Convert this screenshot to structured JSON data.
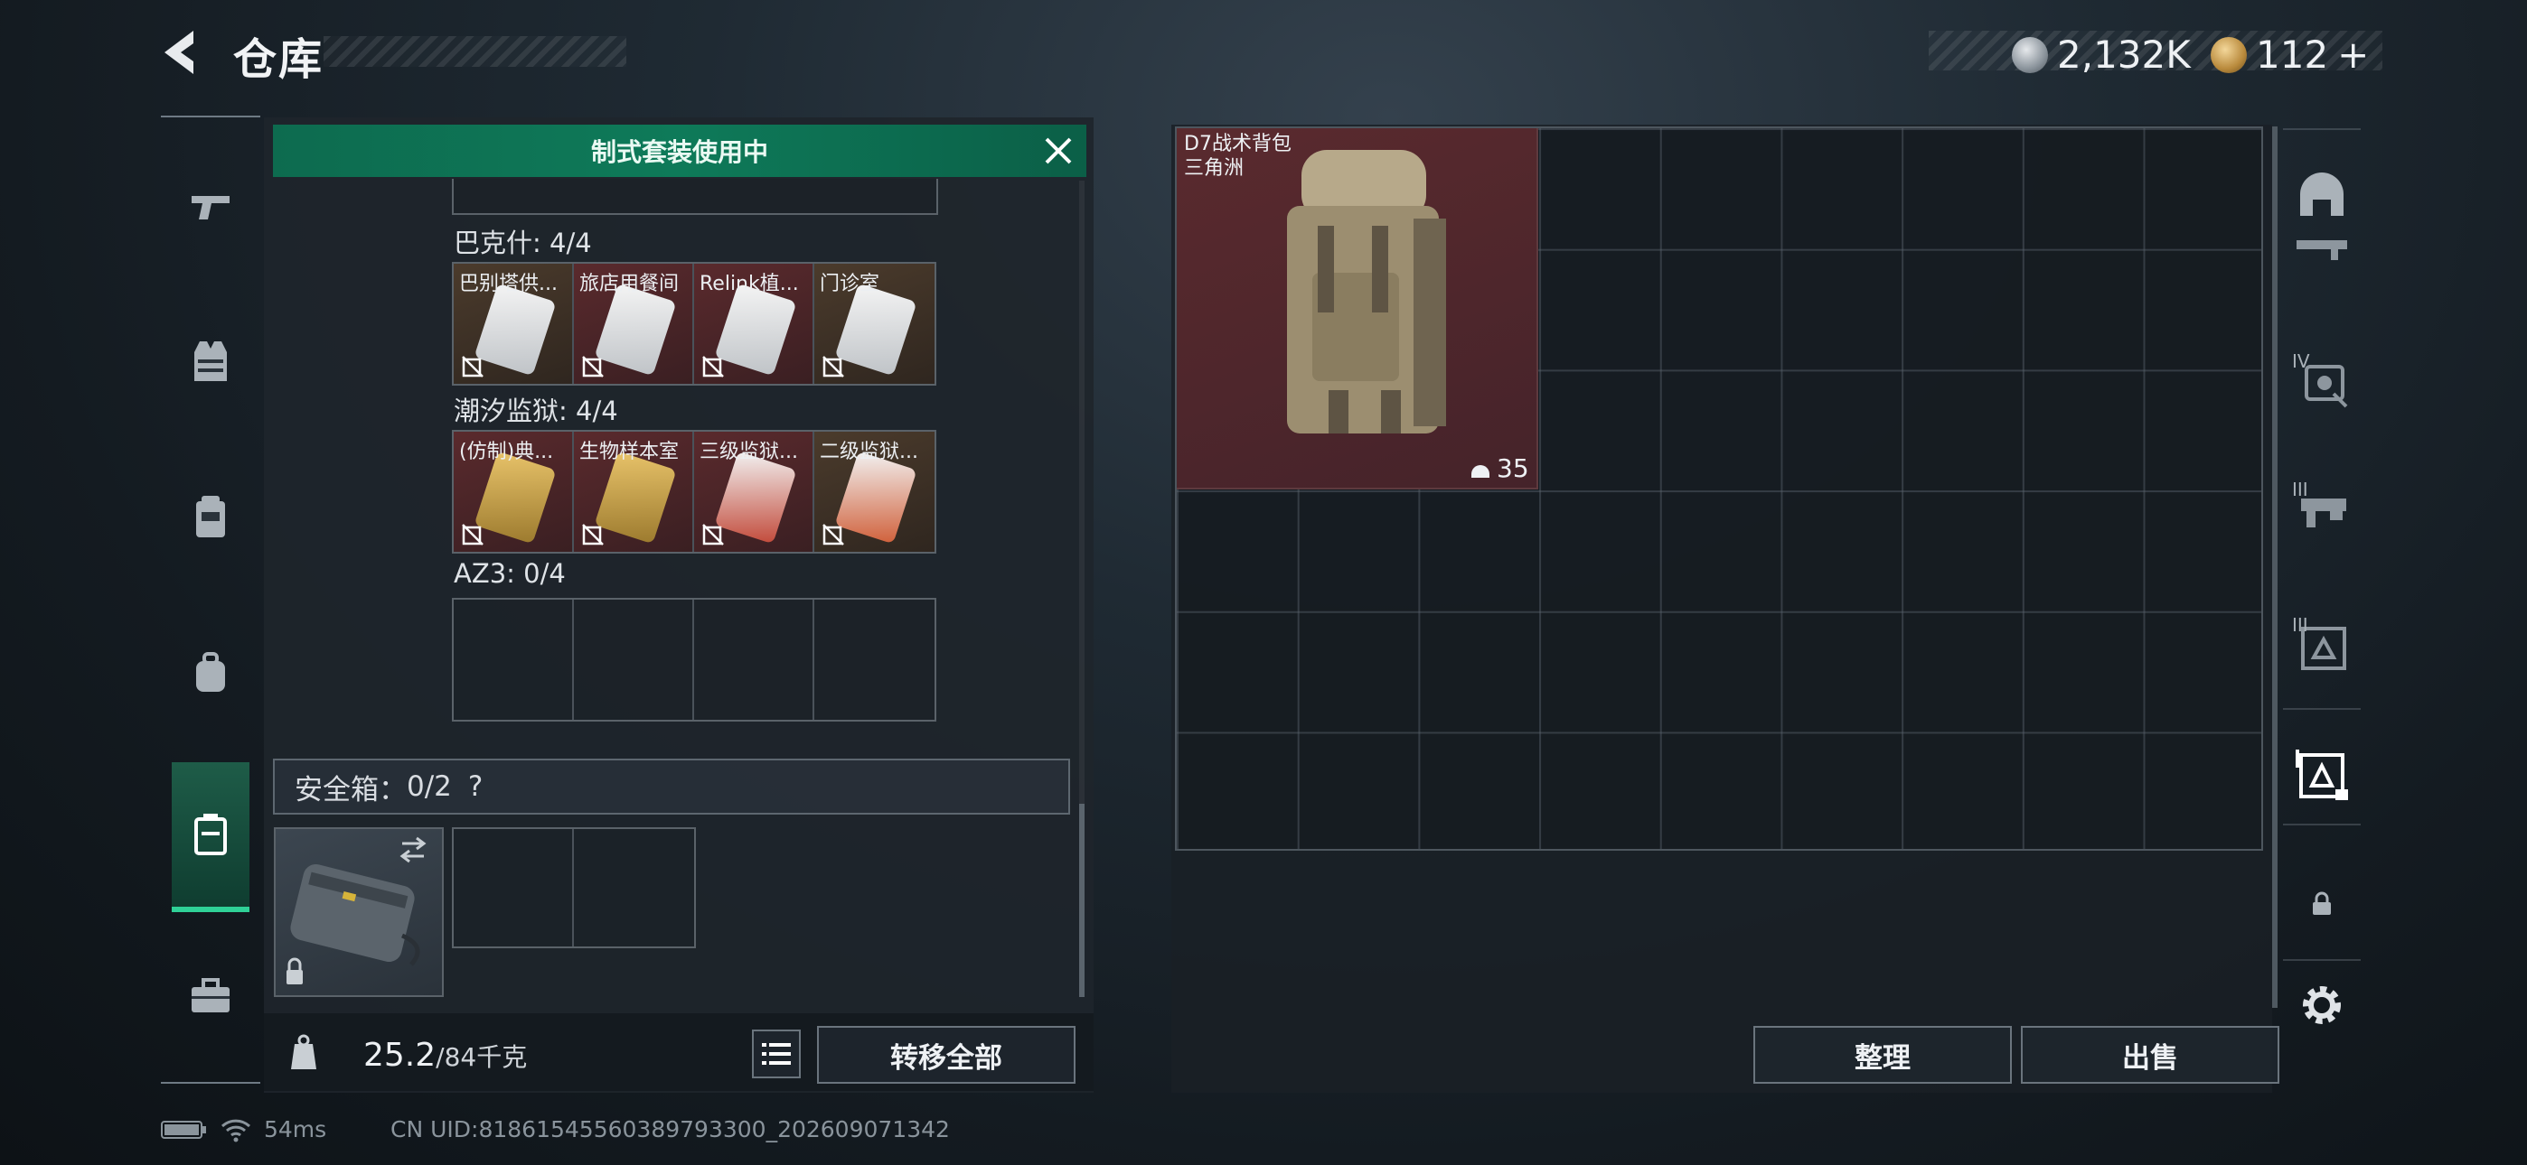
{
  "header": {
    "title": "仓库"
  },
  "currency": {
    "silver": "2,132K",
    "gold": "112",
    "gold_plus": "+"
  },
  "kit_banner": {
    "label": "制式套装使用中"
  },
  "sections": [
    {
      "label": "巴克什: 4/4",
      "cards": [
        {
          "name": "巴别塔供...",
          "style": "brown"
        },
        {
          "name": "旅店用餐间",
          "style": "red"
        },
        {
          "name": "Relink植...",
          "style": "red"
        },
        {
          "name": "门诊室",
          "style": "brown"
        }
      ]
    },
    {
      "label": "潮汐监狱: 4/4",
      "cards": [
        {
          "name": "(仿制)典...",
          "style": "red"
        },
        {
          "name": "生物样本室",
          "style": "red"
        },
        {
          "name": "三级监狱...",
          "style": "red"
        },
        {
          "name": "二级监狱...",
          "style": "brown"
        }
      ]
    },
    {
      "label": "AZ3: 0/4"
    }
  ],
  "safe_box": {
    "label": "安全箱：",
    "count": "0/2",
    "help": "?"
  },
  "weight": {
    "current": "25.2",
    "total": "/84千克"
  },
  "buttons": {
    "transfer_all": "转移全部",
    "sort": "整理",
    "sell": "出售"
  },
  "backpack": {
    "name": "D7战术背包",
    "source": "三角洲",
    "count": "35"
  },
  "right_nav": [
    {
      "badge": "IV"
    },
    {
      "badge": "III"
    },
    {
      "badge": "III"
    }
  ],
  "status": {
    "ping": "54ms",
    "uid": "CN UID:8186154556038979330​0_202609071342"
  },
  "colors": {
    "accent": "#2fd197",
    "banner": "#0e7a59",
    "red_card": "#5a2a2d"
  }
}
